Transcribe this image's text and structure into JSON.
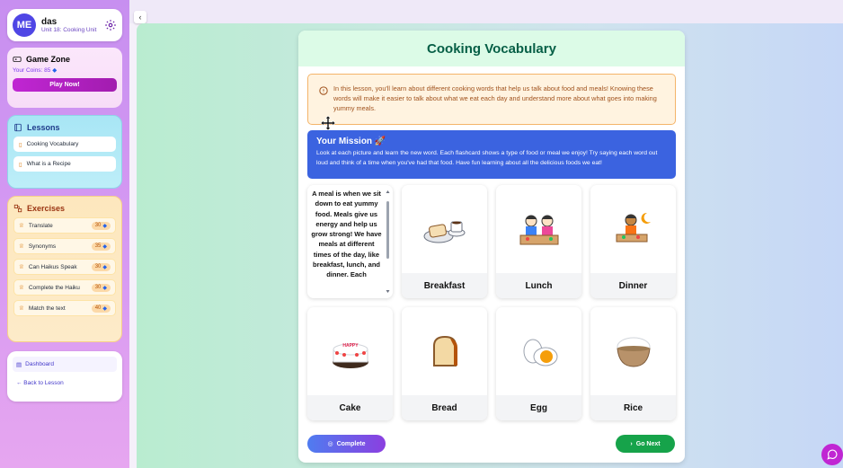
{
  "profile": {
    "initials": "ME",
    "name": "das",
    "unit": "Unit 18: Cooking Unit"
  },
  "game_zone": {
    "title": "Game Zone",
    "coins_label": "Your Coins: 85",
    "play_label": "Play Now!"
  },
  "lessons": {
    "title": "Lessons",
    "items": [
      {
        "label": "Cooking Vocabulary"
      },
      {
        "label": "What is a Recipe"
      }
    ]
  },
  "exercises": {
    "title": "Exercises",
    "items": [
      {
        "label": "Translate",
        "points": "30"
      },
      {
        "label": "Synonyms",
        "points": "35"
      },
      {
        "label": "Can Haikus Speak",
        "points": "30"
      },
      {
        "label": "Complete the Haiku",
        "points": "30"
      },
      {
        "label": "Match the text",
        "points": "40"
      }
    ]
  },
  "nav": {
    "dashboard": "Dashboard",
    "back": "← Back to Lesson"
  },
  "main": {
    "title": "Cooking Vocabulary",
    "info": "In this lesson, you'll learn about different cooking words that help us talk about food and meals! Knowing these words will make it easier to talk about what we eat each day and understand more about what goes into making yummy meals.",
    "mission_title": "Your Mission 🚀",
    "mission_text": "Look at each picture and learn the new word. Each flashcard shows a type of food or meal we enjoy! Try saying each word out loud and think of a time when you've had that food. Have fun learning about all the delicious foods we eat!",
    "description": "A meal is when we sit down to eat yummy food. Meals give us energy and help us grow strong! We have meals at different times of the day, like breakfast, lunch, and dinner. Each",
    "cards": [
      {
        "label": "Breakfast"
      },
      {
        "label": "Lunch"
      },
      {
        "label": "Dinner"
      },
      {
        "label": "Cake"
      },
      {
        "label": "Bread"
      },
      {
        "label": "Egg"
      },
      {
        "label": "Rice"
      }
    ],
    "complete_label": "Complete",
    "next_label": "Go Next"
  }
}
